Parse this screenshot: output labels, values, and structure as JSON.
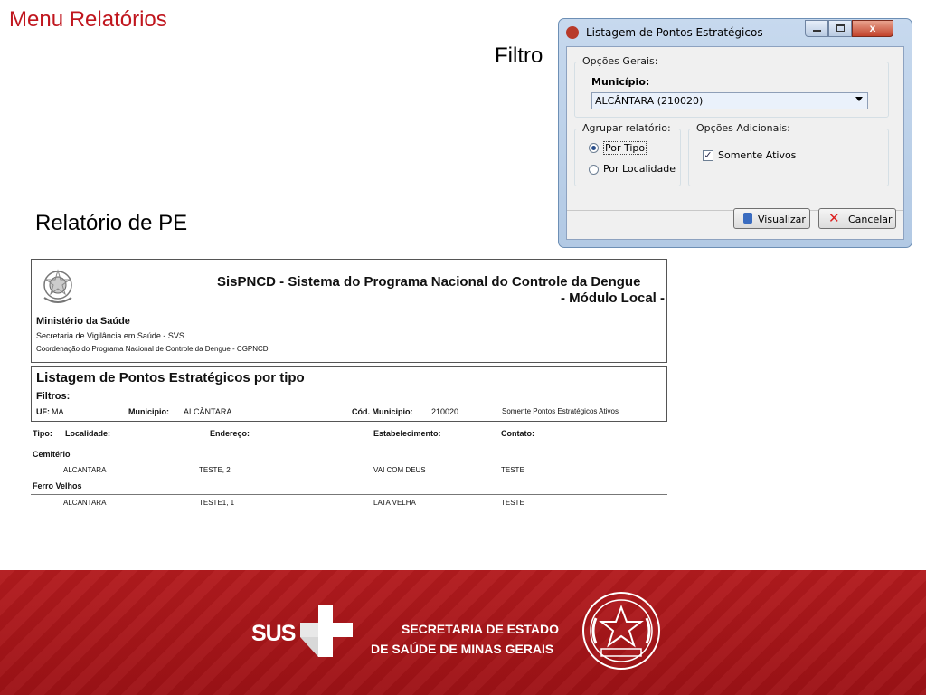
{
  "slide": {
    "title": "Menu Relatórios",
    "filtro_label": "Filtro",
    "relatorio_label": "Relatório de PE"
  },
  "dialog": {
    "title": "Listagem de Pontos Estratégicos",
    "close_glyph": "x",
    "group_geral": "Opções Gerais:",
    "municipio_label": "Município:",
    "municipio_value": "ALCÂNTARA (210020)",
    "group_agrupar": "Agrupar relatório:",
    "radio_tipo": "Por Tipo",
    "radio_localidade": "Por Localidade",
    "radio_selected": "tipo",
    "group_adicionais": "Opções Adicionais:",
    "check_ativos": "Somente Ativos",
    "check_ativos_checked": true,
    "visualizar_label": "Visualizar",
    "cancelar_label": "Cancelar"
  },
  "report": {
    "system_title_1": "SisPNCD - Sistema do Programa Nacional do Controle da Dengue",
    "system_title_2": "- Módulo Local -",
    "ministerio": "Ministério da Saúde",
    "secretaria": "Secretaria de Vigilância em Saúde - SVS",
    "coordenacao": "Coordenação do Programa Nacional de Controle da Dengue - CGPNCD",
    "report_title": "Listagem de Pontos Estratégicos por tipo",
    "filtros_label": "Filtros:",
    "uf_label": "UF:",
    "uf_value": "MA",
    "municipio_label": "Municipio:",
    "municipio_value": "ALCÂNTARA",
    "cod_label": "Cód. Municipio:",
    "cod_value": "210020",
    "somente_text": "Somente Pontos Estratégicos Ativos",
    "columns": {
      "tipo": "Tipo:",
      "localidade": "Localidade:",
      "endereco": "Endereço:",
      "estabelecimento": "Estabelecimento:",
      "contato": "Contato:"
    },
    "groups": [
      {
        "tipo": "Cemitério",
        "rows": [
          {
            "localidade": "ALCANTARA",
            "endereco": "TESTE, 2",
            "estabelecimento": "VAI COM DEUS",
            "contato": "TESTE"
          }
        ]
      },
      {
        "tipo": "Ferro Velhos",
        "rows": [
          {
            "localidade": "ALCANTARA",
            "endereco": "TESTE1, 1",
            "estabelecimento": "LATA VELHA",
            "contato": "TESTE"
          }
        ]
      }
    ]
  },
  "footer": {
    "sus": "SUS",
    "secretaria_line1": "SECRETARIA DE ESTADO",
    "secretaria_line2": "DE SAÚDE DE MINAS GERAIS",
    "colors": {
      "brand_red": "#b31b1e",
      "title_red": "#c0161e"
    }
  }
}
